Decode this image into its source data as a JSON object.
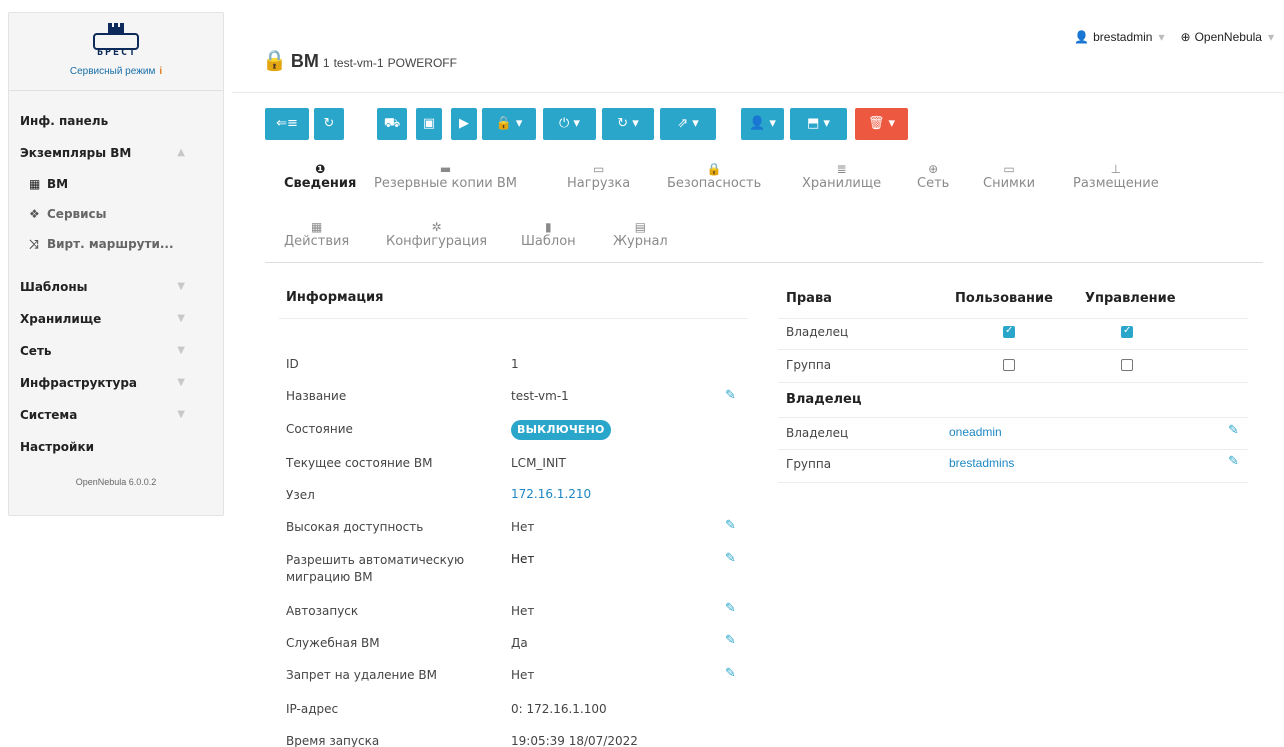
{
  "sidebar": {
    "logo_text": "БРЕСТ",
    "mode_label": "Сервисный режим",
    "mode_warn": "i",
    "items": [
      {
        "label": "Инф. панель"
      },
      {
        "label": "Экземпляры ВМ"
      },
      {
        "label": "ВМ"
      },
      {
        "label": "Сервисы"
      },
      {
        "label": "Вирт. маршрути..."
      },
      {
        "label": "Шаблоны"
      },
      {
        "label": "Хранилище"
      },
      {
        "label": "Сеть"
      },
      {
        "label": "Инфраструктура"
      },
      {
        "label": "Система"
      },
      {
        "label": "Настройки"
      }
    ],
    "version": "OpenNebula 6.0.0.2"
  },
  "header": {
    "user": "brestadmin",
    "zone": "OpenNebula",
    "title": "ВМ",
    "vm_id": "1",
    "vm_name": "test-vm-1",
    "vm_state": "POWEROFF"
  },
  "tabs": [
    {
      "label": "Сведения",
      "icon": "info-icon"
    },
    {
      "label": "Резервные копии ВМ",
      "icon": "archive-icon"
    },
    {
      "label": "Нагрузка",
      "icon": "laptop-icon"
    },
    {
      "label": "Безопасность",
      "icon": "lock-icon"
    },
    {
      "label": "Хранилище",
      "icon": "database-icon"
    },
    {
      "label": "Сеть",
      "icon": "globe-icon"
    },
    {
      "label": "Снимки",
      "icon": "laptop-icon"
    },
    {
      "label": "Размещение",
      "icon": "sitemap-icon"
    },
    {
      "label": "Действия",
      "icon": "calendar-icon"
    },
    {
      "label": "Конфигурация",
      "icon": "cog-icon"
    },
    {
      "label": "Шаблон",
      "icon": "file-icon"
    },
    {
      "label": "Журнал",
      "icon": "file-text-icon"
    }
  ],
  "info": {
    "title": "Информация",
    "rows": [
      {
        "label": "ID",
        "value": "1"
      },
      {
        "label": "Название",
        "value": "test-vm-1"
      },
      {
        "label": "Состояние",
        "value": "ВЫКЛЮЧЕНО"
      },
      {
        "label": "Текущее состояние ВМ",
        "value": "LCM_INIT"
      },
      {
        "label": "Узел",
        "value": "172.16.1.210"
      },
      {
        "label": "Высокая доступность",
        "value": "Нет"
      },
      {
        "label": "Разрешить автоматическую миграцию ВМ",
        "value": "Нет"
      },
      {
        "label": "Автозапуск",
        "value": "Нет"
      },
      {
        "label": "Служебная ВМ",
        "value": "Да"
      },
      {
        "label": "Запрет на удаление ВМ",
        "value": "Нет"
      },
      {
        "label": "IP-адрес",
        "value": "0: 172.16.1.100"
      },
      {
        "label": "Время запуска",
        "value": "19:05:39 18/07/2022"
      }
    ]
  },
  "perms": {
    "col_rights": "Права",
    "col_use": "Пользование",
    "col_manage": "Управление",
    "rows": [
      {
        "label": "Владелец",
        "use": true,
        "manage": true
      },
      {
        "label": "Группа",
        "use": false,
        "manage": false
      }
    ]
  },
  "ownership": {
    "title": "Владелец",
    "rows": [
      {
        "label": "Владелец",
        "value": "oneadmin"
      },
      {
        "label": "Группа",
        "value": "brestadmins"
      }
    ]
  },
  "colors": {
    "accent": "#2ba6cb",
    "danger": "#ec5840",
    "link": "#1e87c4"
  }
}
